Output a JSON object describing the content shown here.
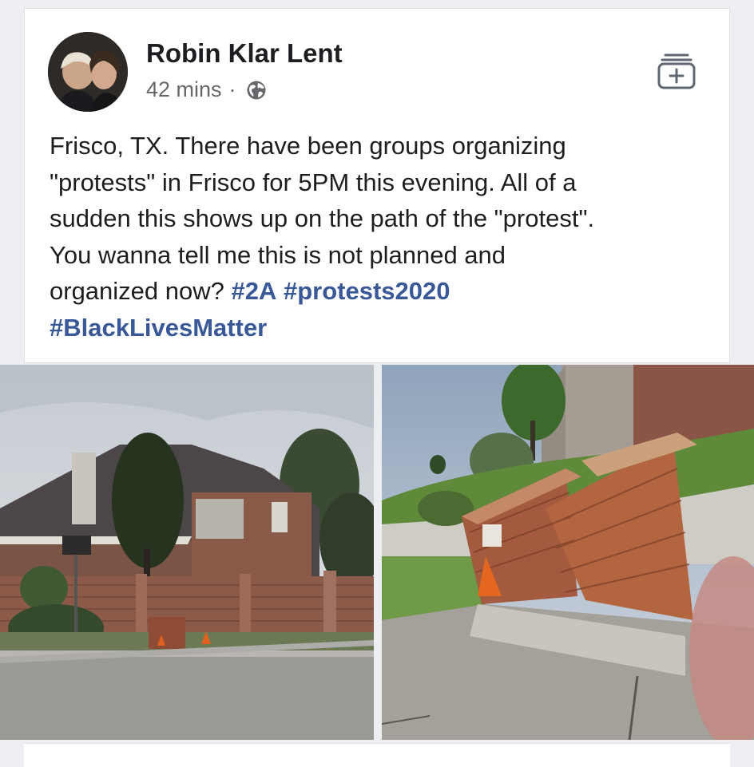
{
  "post": {
    "author_name": "Robin Klar Lent",
    "timestamp": "42 mins",
    "separator": "·",
    "privacy_icon": "globe-icon",
    "save_icon": "save-to-collection-icon",
    "text_lines": [
      "Frisco, TX.  There have been groups organizing",
      "\"protests\" in Frisco for 5PM this evening.  All of a",
      "sudden this shows up on the path of the \"protest\".",
      "You wanna tell me this is not planned and"
    ],
    "line5_text": "organized now? ",
    "hashtags": [
      "#2A",
      "#protests2020",
      "#BlackLivesMatter"
    ]
  },
  "colors": {
    "hashtag": "#385898",
    "text": "#1c1e21",
    "meta": "#65676b",
    "background": "#eceef1"
  }
}
